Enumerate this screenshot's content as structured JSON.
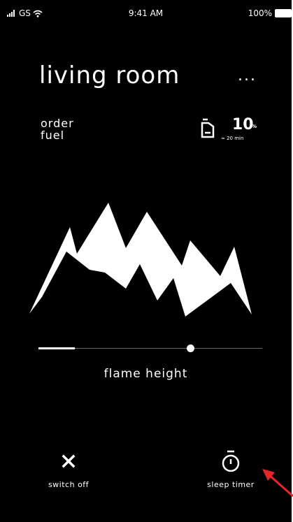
{
  "status_bar": {
    "carrier": "GS",
    "time": "9:41 AM",
    "battery": "100%"
  },
  "header": {
    "title": "living room",
    "more_label": "..."
  },
  "fuel": {
    "order_label": "order\nfuel",
    "level": "10",
    "unit": "%",
    "remaining_time": "≈ 20 min"
  },
  "flame": {
    "slider_value_fraction": 0.68,
    "label": "flame height"
  },
  "actions": {
    "switch_off": "switch off",
    "sleep_timer": "sleep timer"
  },
  "colors": {
    "background": "#000000",
    "foreground": "#ffffff",
    "annotation": "#e8262a"
  }
}
